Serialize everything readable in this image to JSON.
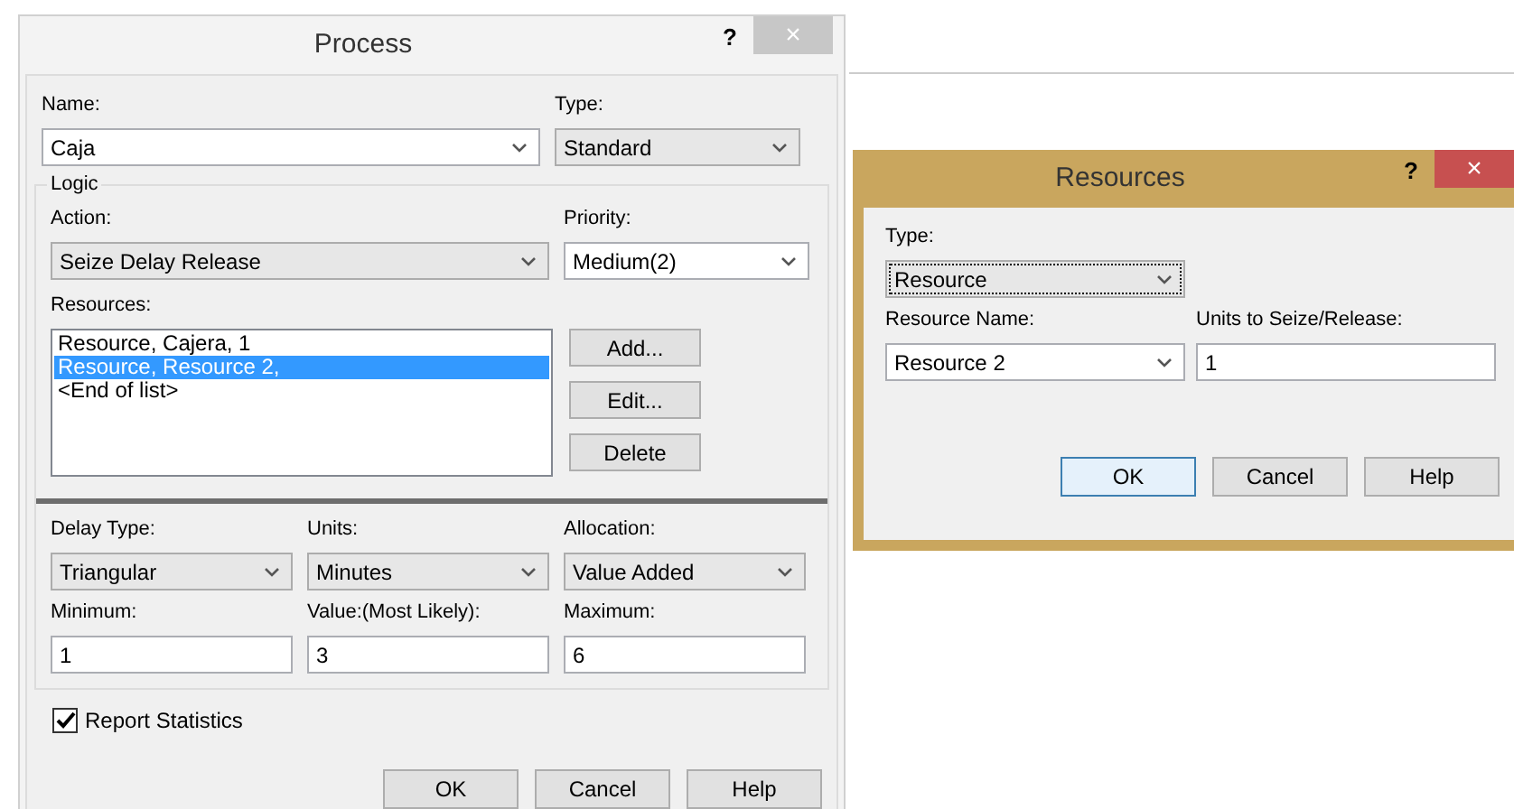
{
  "process": {
    "title": "Process",
    "help": "?",
    "close": "×",
    "top_fields": [
      {
        "label": "Name:",
        "kind": "combo",
        "value": "Caja"
      },
      {
        "label": "Type:",
        "kind": "dropdown",
        "value": "Standard"
      }
    ],
    "logic": {
      "legend": "Logic",
      "action_fields": [
        {
          "label": "Action:",
          "kind": "dropdown",
          "value": "Seize Delay Release"
        },
        {
          "label": "Priority:",
          "kind": "combo",
          "value": "Medium(2)"
        }
      ],
      "resources_label": "Resources:",
      "resources": [
        {
          "text": "Resource, Cajera, 1",
          "selected": false
        },
        {
          "text": "Resource, Resource 2,",
          "selected": true
        },
        {
          "text": "<End of list>",
          "selected": false
        }
      ],
      "list_buttons": [
        "Add...",
        "Edit...",
        "Delete"
      ],
      "delay_fields": [
        {
          "label": "Delay Type:",
          "kind": "dropdown",
          "value": "Triangular"
        },
        {
          "label": "Units:",
          "kind": "dropdown",
          "value": "Minutes"
        },
        {
          "label": "Allocation:",
          "kind": "dropdown",
          "value": "Value Added"
        },
        {
          "label": "Minimum:",
          "kind": "text",
          "value": "1"
        },
        {
          "label": "Value:(Most Likely):",
          "kind": "text",
          "value": "3"
        },
        {
          "label": "Maximum:",
          "kind": "text",
          "value": "6"
        }
      ]
    },
    "report_statistics": {
      "label": "Report Statistics",
      "checked": true
    },
    "buttons": [
      "OK",
      "Cancel",
      "Help"
    ]
  },
  "resources_dialog": {
    "title": "Resources",
    "help": "?",
    "close": "×",
    "fields": [
      {
        "label": "Type:",
        "kind": "dropdown",
        "value": "Resource"
      },
      {
        "label": "Resource Name:",
        "kind": "combo",
        "value": "Resource 2"
      },
      {
        "label": "Units to Seize/Release:",
        "kind": "text",
        "value": "1"
      }
    ],
    "buttons": [
      "OK",
      "Cancel",
      "Help"
    ]
  }
}
